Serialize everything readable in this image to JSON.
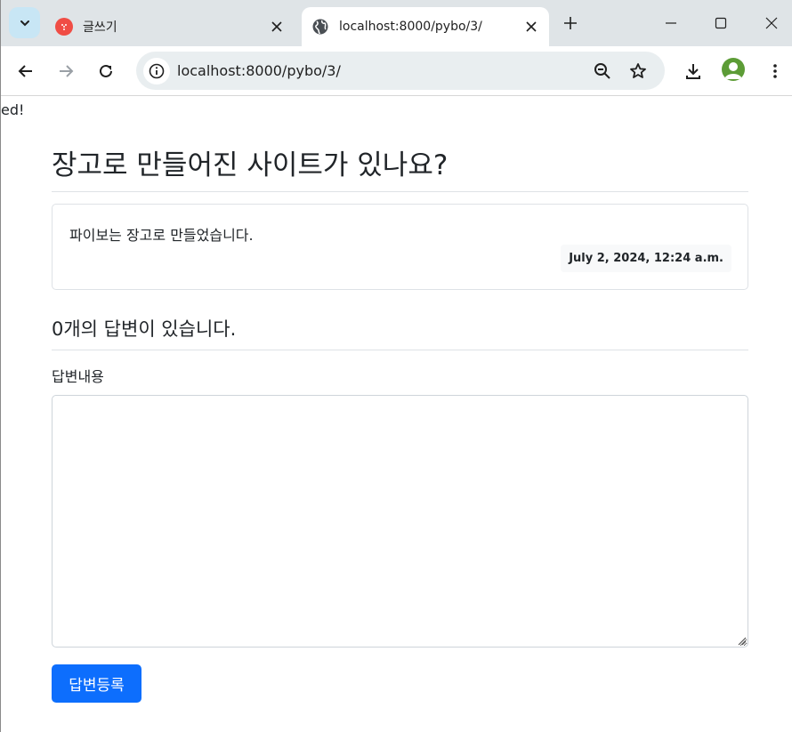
{
  "browser": {
    "tabs": [
      {
        "title": "글쓰기",
        "favicon": "red-circle-app-icon",
        "active": false
      },
      {
        "title": "localhost:8000/pybo/3/",
        "favicon": "globe-icon",
        "active": true
      }
    ],
    "address_bar": {
      "url": "localhost:8000/pybo/3/"
    },
    "accent_color": "#c8e6f5"
  },
  "page": {
    "stray_text": "ed!",
    "question": {
      "subject": "장고로 만들어진 사이트가 있나요?",
      "content": "파이보는 장고로 만들었습니다.",
      "created_date": "July 2, 2024, 12:24 a.m."
    },
    "answer_count_text": "0개의 답변이 있습니다.",
    "answer_form": {
      "label": "답변내용",
      "textarea_value": "",
      "submit_label": "답변등록",
      "submit_color": "#0d6efd"
    }
  }
}
